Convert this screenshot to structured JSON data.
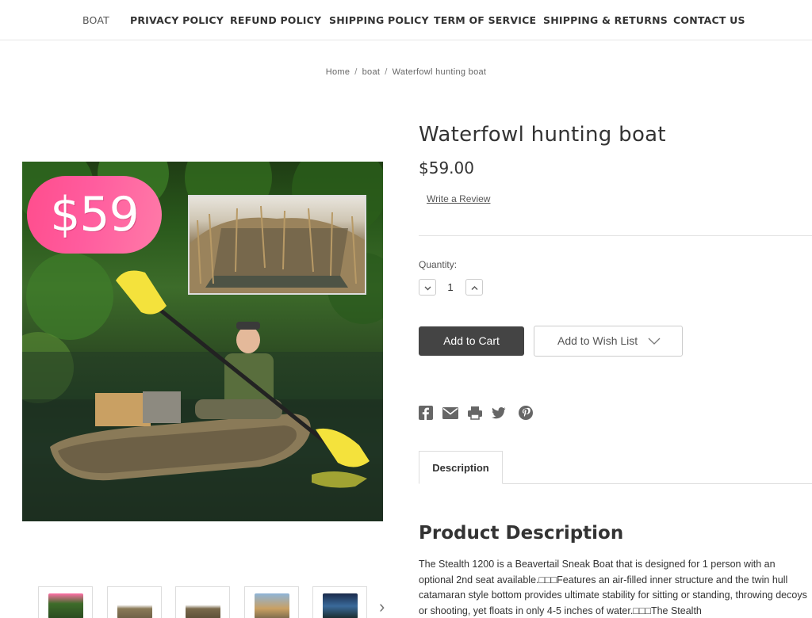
{
  "nav": {
    "items": [
      "BOAT",
      "PRIVACY POLICY",
      "REFUND POLICY",
      "SHIPPING POLICY",
      "TERM OF SERVICE",
      "SHIPPING & RETURNS",
      "CONTACT US"
    ]
  },
  "breadcrumb": {
    "home": "Home",
    "category": "boat",
    "current": "Waterfowl hunting boat",
    "separator": "/"
  },
  "product": {
    "title": "Waterfowl hunting boat",
    "price": "$59.00",
    "review_link": "Write a Review",
    "badge_text": "$59",
    "quantity_label": "Quantity:",
    "quantity": "1",
    "add_to_cart": "Add to Cart",
    "add_to_wishlist": "Add to Wish List"
  },
  "share_icons": [
    "facebook-icon",
    "email-icon",
    "print-icon",
    "twitter-icon",
    "pinterest-icon"
  ],
  "tabs": {
    "description": "Description"
  },
  "description": {
    "heading": "Product Description",
    "text": "The Stealth 1200 is a Beavertail Sneak Boat that is designed for 1 person with an optional 2nd seat available.□□□Features an air-filled inner structure and the twin hull catamaran style bottom provides ultimate stability for sitting or standing, throwing decoys or shooting, yet floats in only 4-5 inches of water.□□□The Stealth"
  },
  "colors": {
    "cart_button": "#444444",
    "badge": "#ff5c9e"
  }
}
